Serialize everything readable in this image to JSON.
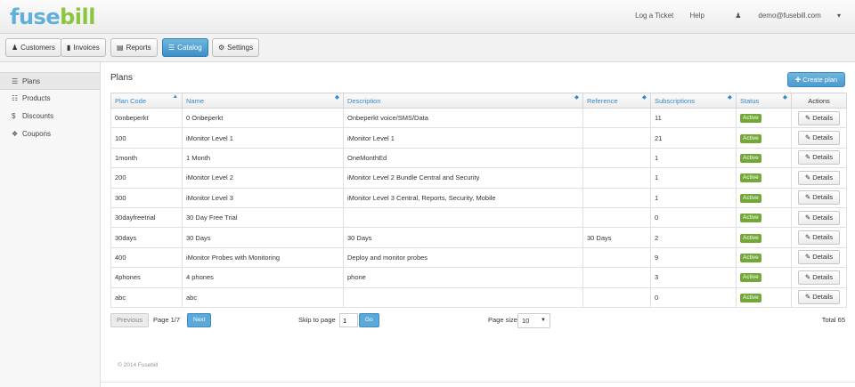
{
  "header": {
    "logo": {
      "main": "fuse",
      "accent": "bill"
    },
    "links": {
      "log_ticket": "Log a Ticket",
      "help": "Help",
      "user": "demo@fusebill.com"
    },
    "user_icon": "user-icon",
    "dropdown_icon": "caret-down-icon"
  },
  "nav": {
    "customers": "Customers",
    "invoices": "Invoices",
    "reports": "Reports",
    "catalog": "Catalog",
    "settings": "Settings"
  },
  "sidebar": {
    "items": [
      {
        "label": "Plans",
        "icon": "list-icon"
      },
      {
        "label": "Products",
        "icon": "barcode-icon"
      },
      {
        "label": "Discounts",
        "icon": "dollar-icon"
      },
      {
        "label": "Coupons",
        "icon": "gift-icon"
      }
    ]
  },
  "main": {
    "title": "Plans",
    "create_label": "Create plan",
    "columns": [
      "Plan Code",
      "Name",
      "Description",
      "Reference",
      "Subscriptions",
      "Status",
      "Actions"
    ],
    "rows": [
      {
        "code": "0onbeperkt",
        "name": "0 Onbeperkt",
        "description": "Onbeperkt voice/SMS/Data",
        "reference": "",
        "subs": "11",
        "status": "Active",
        "action": "Details"
      },
      {
        "code": "100",
        "name": "iMonitor Level 1",
        "description": "iMonitor Level 1",
        "reference": "",
        "subs": "21",
        "status": "Active",
        "action": "Details"
      },
      {
        "code": "1month",
        "name": "1 Month",
        "description": "OneMonthEd",
        "reference": "",
        "subs": "1",
        "status": "Active",
        "action": "Details"
      },
      {
        "code": "200",
        "name": "iMonitor Level 2",
        "description": "iMonitor Level 2 Bundle Central and Security",
        "reference": "",
        "subs": "1",
        "status": "Active",
        "action": "Details"
      },
      {
        "code": "300",
        "name": "iMonitor Level 3",
        "description": "iMonitor Level 3 Central, Reports, Security, Mobile",
        "reference": "",
        "subs": "1",
        "status": "Active",
        "action": "Details"
      },
      {
        "code": "30dayfreetrial",
        "name": "30 Day Free Trial",
        "description": "",
        "reference": "",
        "subs": "0",
        "status": "Active",
        "action": "Details"
      },
      {
        "code": "30days",
        "name": "30 Days",
        "description": "30 Days",
        "reference": "30 Days",
        "subs": "2",
        "status": "Active",
        "action": "Details"
      },
      {
        "code": "400",
        "name": "iMonitor Probes with Monitoring",
        "description": "Deploy and monitor probes",
        "reference": "",
        "subs": "9",
        "status": "Active",
        "action": "Details"
      },
      {
        "code": "4phones",
        "name": "4 phones",
        "description": "phone",
        "reference": "",
        "subs": "3",
        "status": "Active",
        "action": "Details"
      },
      {
        "code": "abc",
        "name": "abc",
        "description": "",
        "reference": "",
        "subs": "0",
        "status": "Active",
        "action": "Details"
      }
    ]
  },
  "pager": {
    "previous": "Previous",
    "page_info": "Page 1/7",
    "next": "Next",
    "skip_label": "Skip to page",
    "skip_value": "1",
    "go": "Go",
    "size_label": "Page size",
    "size_value": "10",
    "total": "Total 65"
  },
  "footer": {
    "copyright": "© 2014 Fusebill"
  },
  "colors": {
    "brand_blue": "#5fb0da",
    "brand_green": "#8cc63f",
    "active_badge": "#73a839",
    "link": "#3b88c3"
  }
}
